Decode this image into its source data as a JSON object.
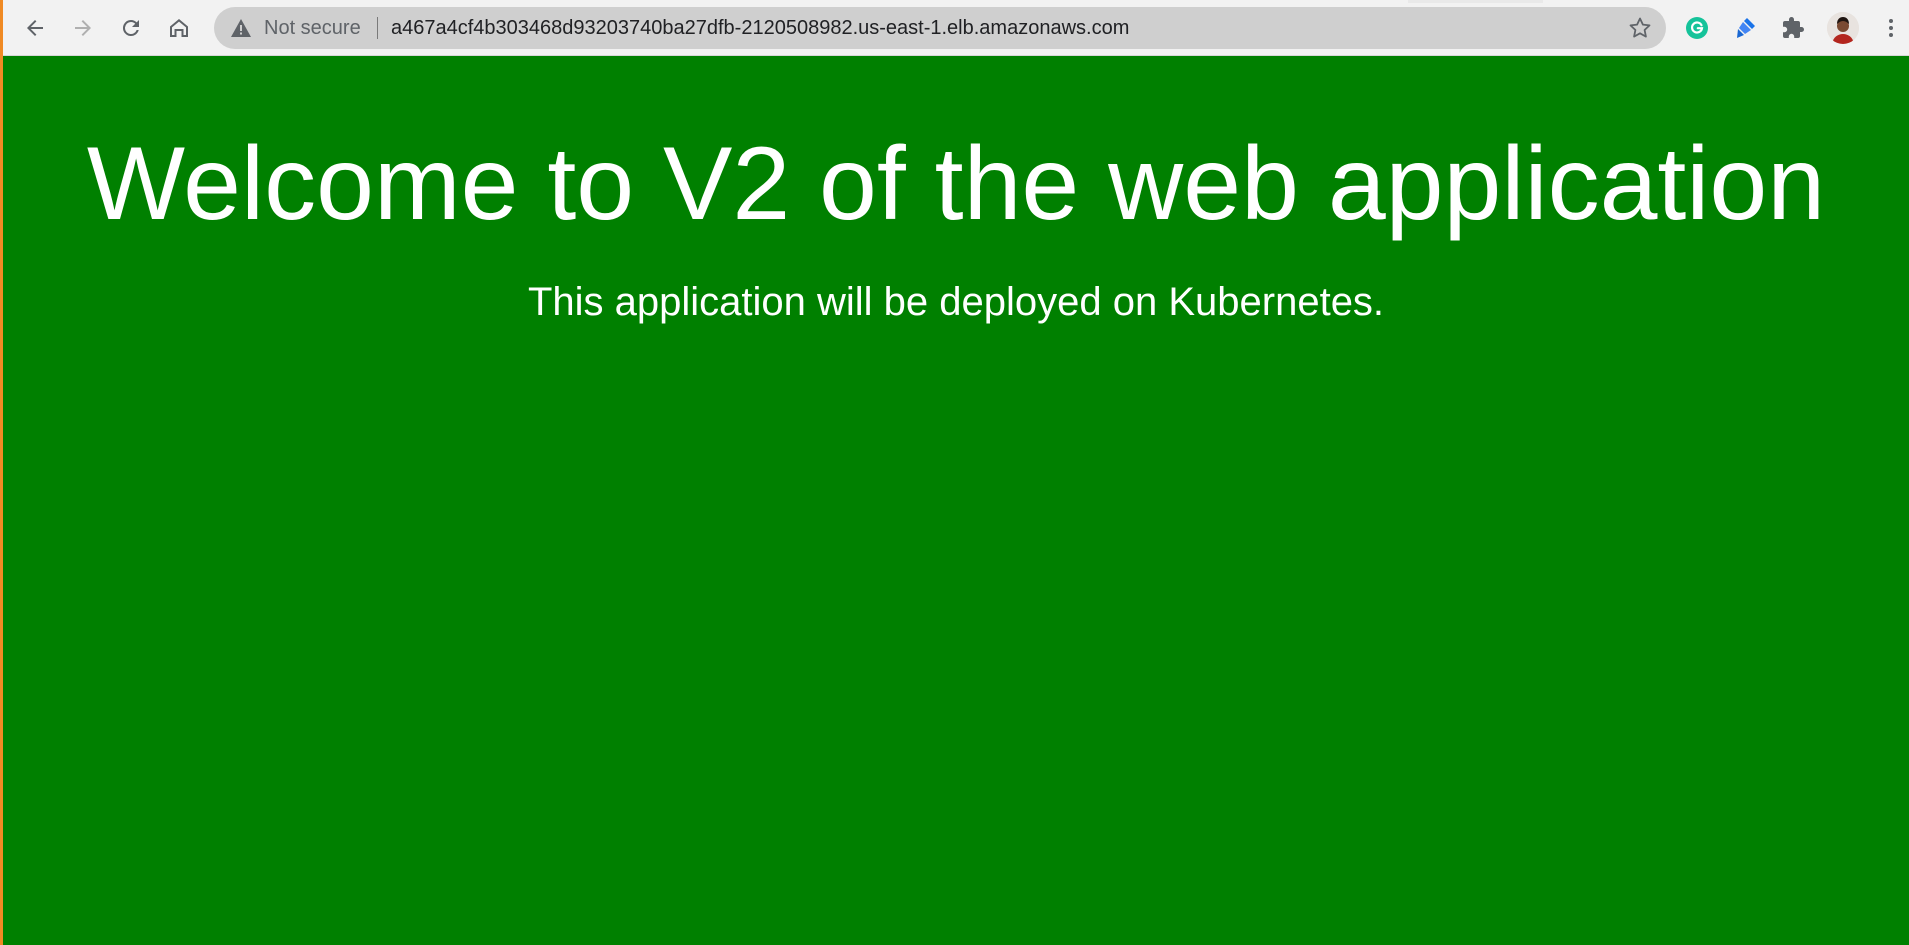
{
  "browser": {
    "security_label": "Not secure",
    "url": "a467a4cf4b303468d93203740ba27dfb-2120508982.us-east-1.elb.amazonaws.com",
    "icons": {
      "back": "back-arrow-icon",
      "forward": "forward-arrow-icon",
      "reload": "reload-icon",
      "home": "home-icon",
      "security": "warning-triangle-icon",
      "bookmark": "star-icon",
      "grammarly": "grammarly-icon",
      "extension": "blue-pen-extension-icon",
      "extensions_menu": "puzzle-icon",
      "profile": "avatar",
      "menu": "kebab-menu-icon"
    }
  },
  "page": {
    "heading": "Welcome to V2 of the web application",
    "subtext": "This application will be deployed on Kubernetes.",
    "background_color": "#008000",
    "text_color": "#ffffff"
  }
}
